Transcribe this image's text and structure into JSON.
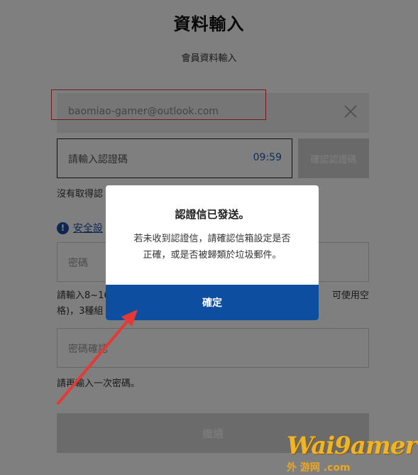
{
  "header": {
    "title": "資料輸入",
    "subtitle": "會員資料輸入"
  },
  "email_field": {
    "value": "baomiao-gamer@outlook.com",
    "clear_icon": "close-icon"
  },
  "code_field": {
    "placeholder": "請輸入認證碼",
    "timer": "09:59"
  },
  "verify_button": {
    "label": "確認認證碼"
  },
  "no_code_text": "沒有取得認",
  "security": {
    "icon": "info-icon",
    "icon_glyph": "!",
    "link_text": "安全設"
  },
  "password_field": {
    "placeholder": "密碼"
  },
  "password_hint": {
    "left": "請輸入8~16",
    "right": "可使用空",
    "line2": "格)，3種組"
  },
  "confirm_field": {
    "placeholder": "密碼確認"
  },
  "confirm_hint": "請再輸入一次密碼。",
  "continue_button": {
    "label": "繼續"
  },
  "modal": {
    "title": "認證信已發送。",
    "message_line1": "若未收到認證信，請確認信箱設定是否",
    "message_line2": "正確，或是否被歸類於垃圾郵件。",
    "ok_label": "確定"
  },
  "watermark": {
    "main": "Wai9amer",
    "sub": "外 游网 .com"
  },
  "colors": {
    "primary": "#0d4ea0",
    "link": "#1a4fa0",
    "timer": "#1a5fb4",
    "annotation": "#e53935"
  }
}
